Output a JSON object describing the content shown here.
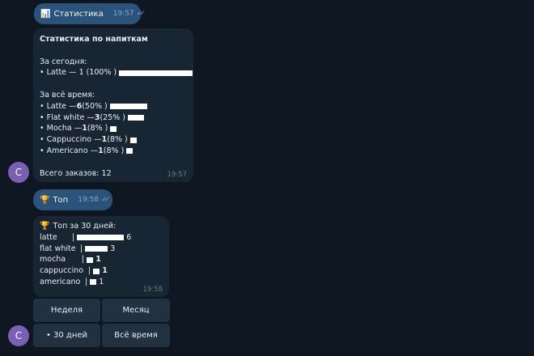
{
  "messages": {
    "cmd_stats": {
      "emoji": "📊",
      "text": "Статистика",
      "time": "19:57"
    },
    "stats": {
      "title": "Статистика по напиткам",
      "today_label": "За сегодня:",
      "today_items": [
        {
          "text": "• Latte — 1 (100% )",
          "share": 1.0
        }
      ],
      "alltime_label": "За всё время:",
      "alltime_items": [
        {
          "name": "• Latte — ",
          "count": "6",
          "pct": " (50% )",
          "share": 0.5
        },
        {
          "name": "• Flat white — ",
          "count": "3",
          "pct": " (25% )",
          "share": 0.25
        },
        {
          "name": "• Mocha — ",
          "count": "1",
          "pct": " (8% )",
          "share": 0.083
        },
        {
          "name": "• Cappuccino — ",
          "count": "1",
          "pct": " (8% )",
          "share": 0.083
        },
        {
          "name": "• Americano — ",
          "count": "1",
          "pct": " (8% )",
          "share": 0.083
        }
      ],
      "total": "Всего заказов: 12",
      "time": "19:57"
    },
    "cmd_top": {
      "emoji": "🏆",
      "text": "Топ",
      "time": "19:58"
    },
    "top": {
      "emoji": "🏆",
      "title": "Топ за 30 дней:",
      "rows": [
        {
          "name": "latte",
          "sep": "|",
          "value": "6",
          "share": 1.0
        },
        {
          "name": "flat white",
          "sep": "|",
          "value": "3",
          "share": 0.5
        },
        {
          "name": "mocha",
          "sep": "|",
          "value": "1",
          "share": 0.167
        },
        {
          "name": "cappuccino",
          "sep": "|",
          "value": "1",
          "share": 0.167
        },
        {
          "name": "americano",
          "sep": "|",
          "value": "1",
          "share": 0.167
        }
      ],
      "time": "19:58"
    }
  },
  "keyboard": {
    "week": "Неделя",
    "month": "Месяц",
    "days30": "• 30 дней",
    "alltime": "Всё время"
  },
  "avatar_letter": "С",
  "colors": {
    "background": "#0e1621",
    "outgoing": "#2b5278",
    "incoming": "#182533",
    "keyboard_button": "#223142",
    "avatar": "#7a5fb4"
  }
}
